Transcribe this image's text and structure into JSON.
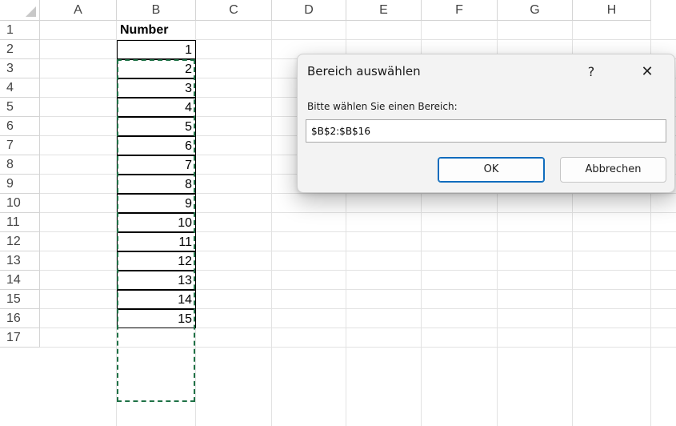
{
  "sheet": {
    "columns": [
      "A",
      "B",
      "C",
      "D",
      "E",
      "F",
      "G",
      "H"
    ],
    "rows": [
      "1",
      "2",
      "3",
      "4",
      "5",
      "6",
      "7",
      "8",
      "9",
      "10",
      "11",
      "12",
      "13",
      "14",
      "15",
      "16",
      "17"
    ],
    "column_b_header": "Number",
    "column_b_values": [
      "1",
      "2",
      "3",
      "4",
      "5",
      "6",
      "7",
      "8",
      "9",
      "10",
      "11",
      "12",
      "13",
      "14",
      "15"
    ],
    "selection_color": "#1e7145"
  },
  "dialog": {
    "title": "Bereich auswählen",
    "help_label": "?",
    "close_label": "✕",
    "prompt": "Bitte wählen Sie einen Bereich:",
    "input_value": "$B$2:$B$16",
    "ok_label": "OK",
    "cancel_label": "Abbrechen"
  }
}
